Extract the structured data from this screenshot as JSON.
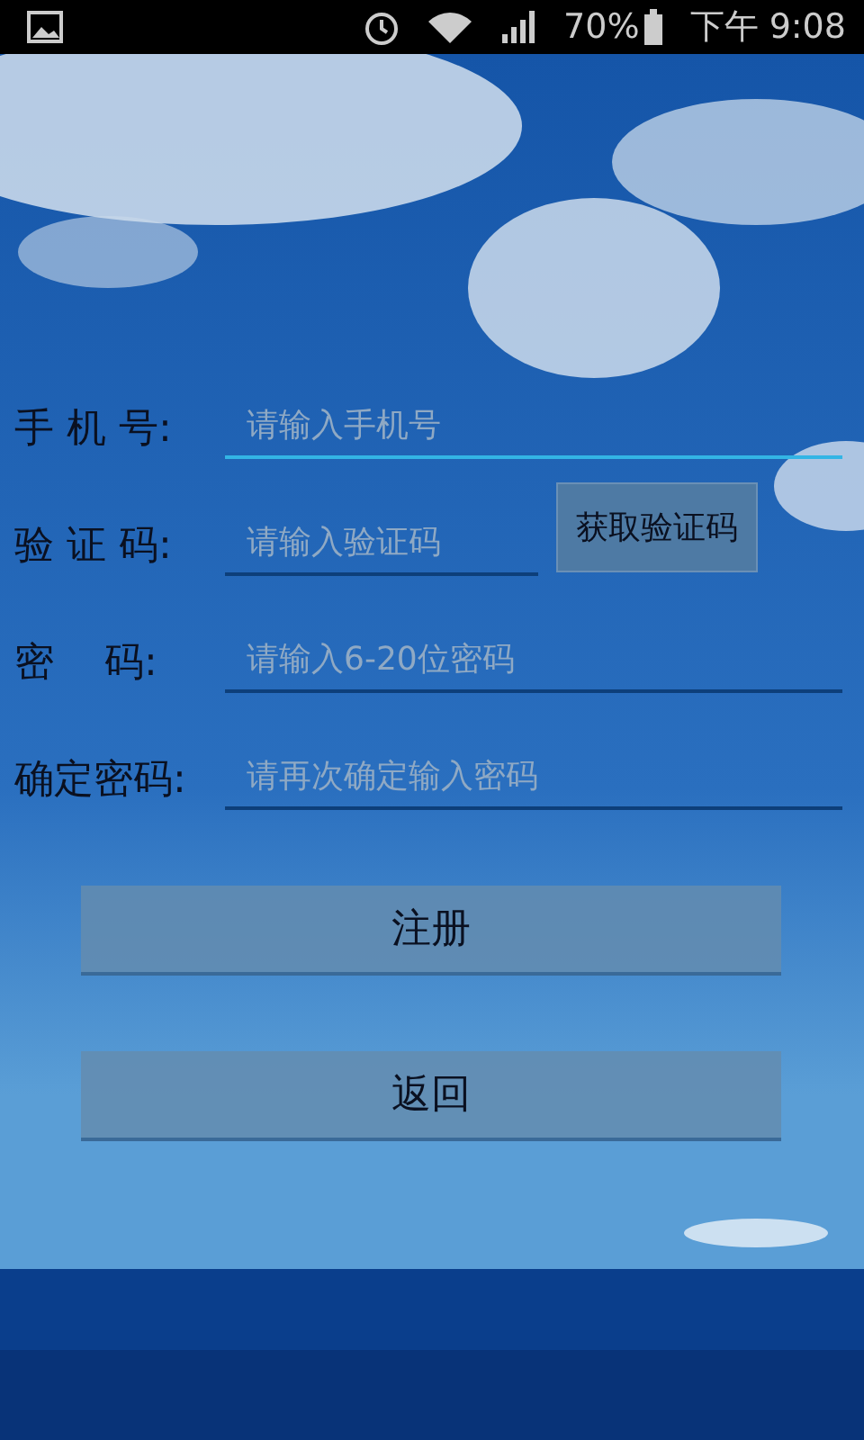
{
  "status_bar": {
    "battery": "70%",
    "time": "下午 9:08"
  },
  "form": {
    "fields": [
      {
        "label": "手 机 号:",
        "placeholder": "请输入手机号",
        "focused": true,
        "kind": "text"
      },
      {
        "label": "验 证 码:",
        "placeholder": "请输入验证码",
        "focused": false,
        "kind": "code",
        "button": "获取验证码"
      },
      {
        "label": "密    码:",
        "placeholder": "请输入6-20位密码",
        "focused": false,
        "kind": "text"
      },
      {
        "label": "确定密码:",
        "placeholder": "请再次确定输入密码",
        "focused": false,
        "kind": "text"
      }
    ]
  },
  "buttons": [
    "注册",
    "返回"
  ]
}
